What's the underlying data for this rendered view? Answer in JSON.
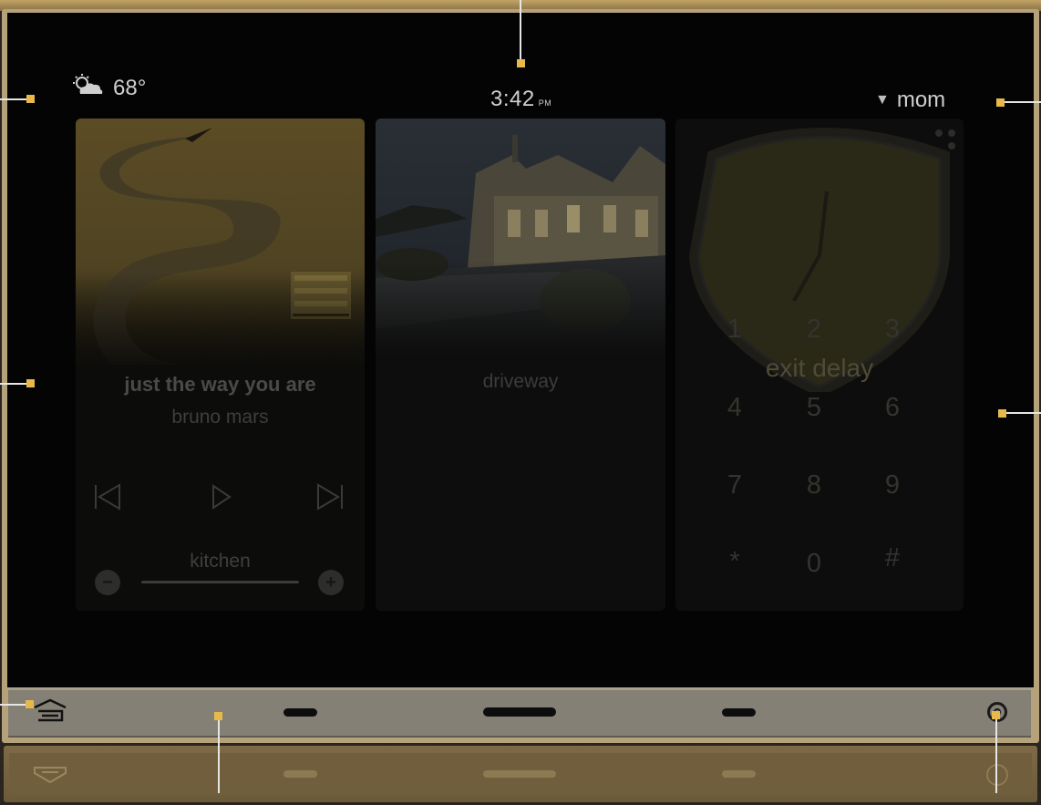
{
  "status": {
    "temperature": "68°",
    "time": "3:42",
    "ampm": "PM",
    "user": "mom"
  },
  "music": {
    "song": "just the way you are",
    "artist": "bruno mars",
    "zone": "kitchen",
    "prev": "⏮",
    "play": "▷",
    "next": "⏭",
    "vol_down": "−",
    "vol_up": "+"
  },
  "camera": {
    "label": "driveway"
  },
  "security": {
    "status": "exit delay",
    "keys": [
      "1",
      "2",
      "3",
      "4",
      "5",
      "6",
      "7",
      "8",
      "9",
      "*",
      "0",
      "#"
    ]
  },
  "colors": {
    "callout": "#e8b94a",
    "bezel": "#b5a27a",
    "navbar": "#858075"
  }
}
